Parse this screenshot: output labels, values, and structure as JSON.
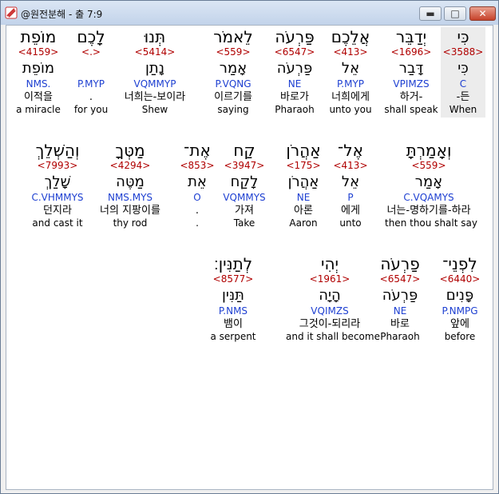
{
  "window": {
    "title": "@원전분해 - 출 7:9",
    "icon": "app-icon",
    "controls": {
      "minimize": "minimize-icon",
      "maximize": "maximize-icon",
      "close": "close-icon"
    }
  },
  "rows": [
    [
      {
        "heb": "כִּי",
        "strong": "<3588>",
        "lemma": "כִּי",
        "parse": "C",
        "ko": "-든",
        "en": "When",
        "selected": true
      },
      {
        "heb": "יְדַבֵּר",
        "strong": "<1696>",
        "lemma": "דָּבַר",
        "parse": "VPIMZS",
        "ko": "하거-",
        "en": "shall speak"
      },
      {
        "heb": "אֲלֵכֶם",
        "strong": "<413>",
        "lemma": "אֵל",
        "parse": "P.MYP",
        "ko": "너희에게",
        "en": "unto you"
      },
      {
        "heb": "פַּרְעֹה",
        "strong": "<6547>",
        "lemma": "פַּרְעֹה",
        "parse": "NE",
        "ko": "바로가",
        "en": "Pharaoh"
      },
      {
        "heb": "לֵאמֹר",
        "strong": "<559>",
        "lemma": "אָמַר",
        "parse": "P.VQNG",
        "ko": "이르기를",
        "en": "saying"
      },
      {
        "heb": "תְּנוּ",
        "strong": "<5414>",
        "lemma": "נָתַן",
        "parse": "VQMMYP",
        "ko": "너희는-보이라",
        "en": "Shew"
      },
      {
        "heb": "לָכֶם",
        "strong": "<.>",
        "lemma": "",
        "parse": "P.MYP",
        "ko": ".",
        "en": "for you"
      },
      {
        "heb": "מוֹפֵת",
        "strong": "<4159>",
        "lemma": "מוֹפֵת",
        "parse": "NMS.",
        "ko": "이적을",
        "en": "a miracle"
      }
    ],
    [
      {
        "heb": "וְאָמַרְתָּ",
        "strong": "<559>",
        "lemma": "אָמַר",
        "parse": "C.VQAMYS",
        "ko": "너는-명하기를-하라",
        "en": "then thou shalt say"
      },
      {
        "heb": "אֶל־",
        "strong": "<413>",
        "lemma": "אֵל",
        "parse": "P",
        "ko": "에게",
        "en": "unto"
      },
      {
        "heb": "אַהֲרֹן",
        "strong": "<175>",
        "lemma": "אַהֲרֹן",
        "parse": "NE",
        "ko": "아론",
        "en": "Aaron"
      },
      {
        "heb": "קַח",
        "strong": "<3947>",
        "lemma": "לָקַח",
        "parse": "VQMMYS",
        "ko": "가져",
        "en": "Take"
      },
      {
        "heb": "אֶת־",
        "strong": "<853>",
        "lemma": "אֵת",
        "parse": "O",
        "ko": ".",
        "en": "."
      },
      {
        "heb": "מַטְּךָ",
        "strong": "<4294>",
        "lemma": "מַטֶּה",
        "parse": "NMS.MYS",
        "ko": "너의 지팡이를",
        "en": "thy rod"
      },
      {
        "heb": "וְהַשְׁלֵךְ",
        "strong": "<7993>",
        "lemma": "שָׁלַךְ",
        "parse": "C.VHMMYS",
        "ko": "던지라",
        "en": "and cast it"
      }
    ],
    [
      {
        "heb": "לִפְנֵי־",
        "strong": "<6440>",
        "lemma": "פָּנִים",
        "parse": "P.NMPG",
        "ko": "앞에",
        "en": "before"
      },
      {
        "heb": "פַרְעֹה",
        "strong": "<6547>",
        "lemma": "פַּרְעֹה",
        "parse": "NE",
        "ko": "바로",
        "en": "Pharaoh"
      },
      {
        "heb": "יְהִי",
        "strong": "<1961>",
        "lemma": "הָיָה",
        "parse": "VQIMZS",
        "ko": "그것이-되리라",
        "en": "and it shall become"
      },
      {
        "heb": "לְתַנִּין׃",
        "strong": "<8577>",
        "lemma": "תַּנִּין",
        "parse": "P.NMS",
        "ko": "뱀이",
        "en": "a serpent"
      }
    ]
  ]
}
